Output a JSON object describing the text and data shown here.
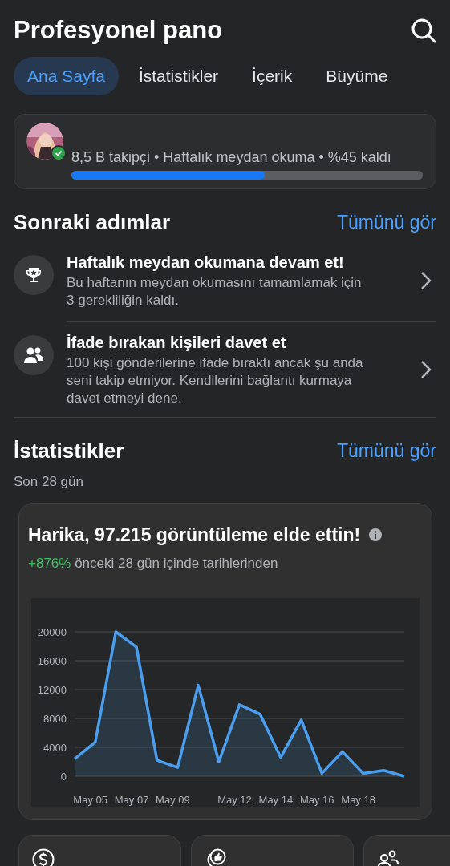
{
  "header": {
    "title": "Profesyonel pano"
  },
  "tabs": [
    {
      "label": "Ana Sayfa",
      "selected": true
    },
    {
      "label": "İstatistikler",
      "selected": false
    },
    {
      "label": "İçerik",
      "selected": false
    },
    {
      "label": "Büyüme",
      "selected": false
    }
  ],
  "profile_card": {
    "verified": true,
    "summary": "8,5 B takipçi • Haftalık meydan okuma • %45 kaldı",
    "level": 0.55
  },
  "next_steps": {
    "title": "Sonraki adımlar",
    "link": "Tümünü gör",
    "items": [
      {
        "kind": "trophy",
        "title": "Haftalık meydan okumana devam et!",
        "text": "Bu haftanın meydan okumasını tamamlamak için 3 gerekliliğin kaldı."
      },
      {
        "kind": "people",
        "title": "İfade bırakan kişileri davet et",
        "text": "100 kişi gönderilerine ifade bıraktı ancak şu anda seni takip etmiyor. Kendilerini bağlantı kurmaya davet etmeyi dene."
      }
    ]
  },
  "stats": {
    "title": "İstatistikler",
    "link": "Tümünü gör",
    "period": "Son 28 gün",
    "card": {
      "headline": "Harika, 97.215 görüntüleme elde ettin!",
      "change": "+876%",
      "change_text": "önceki 28 gün içinde tarihlerinden",
      "chart_data": {
        "type": "area",
        "categories": [
          null,
          "May 05",
          null,
          "May 07",
          null,
          "May 09",
          null,
          null,
          "May 12",
          null,
          "May 14",
          null,
          "May 16",
          null,
          "May 18",
          null,
          null
        ],
        "series": [
          {
            "color": "#4a9eed",
            "values": [
              2400,
              4700,
              20000,
              17900,
              2200,
              1200,
              12600,
              2000,
              9900,
              8600,
              2600,
              7800,
              400,
              3400,
              400,
              800,
              0
            ]
          }
        ],
        "grid": true,
        "ylim": [
          0,
          20000
        ],
        "yticks": [
          0,
          4000,
          8000,
          12000,
          16000,
          20000
        ]
      }
    }
  },
  "bottom_cards": [
    {
      "kind": "dollar"
    },
    {
      "kind": "like"
    },
    {
      "kind": "people"
    }
  ]
}
